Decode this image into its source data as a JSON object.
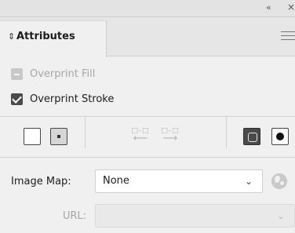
{
  "window": {
    "collapse_glyph": "«",
    "close_glyph": "×"
  },
  "panel": {
    "title": "Attributes"
  },
  "checkboxes": {
    "overprint_fill": {
      "label": "Overprint Fill",
      "checked": false,
      "enabled": false
    },
    "overprint_stroke": {
      "label": "Overprint Stroke",
      "checked": true,
      "enabled": true
    }
  },
  "image_map": {
    "label": "Image Map:",
    "value": "None"
  },
  "url": {
    "label": "URL:",
    "value": ""
  },
  "colors": {
    "background": "#f0f0f0",
    "checkbox_checked": "#4b4b4b",
    "disabled_text": "#a6a6a6"
  }
}
